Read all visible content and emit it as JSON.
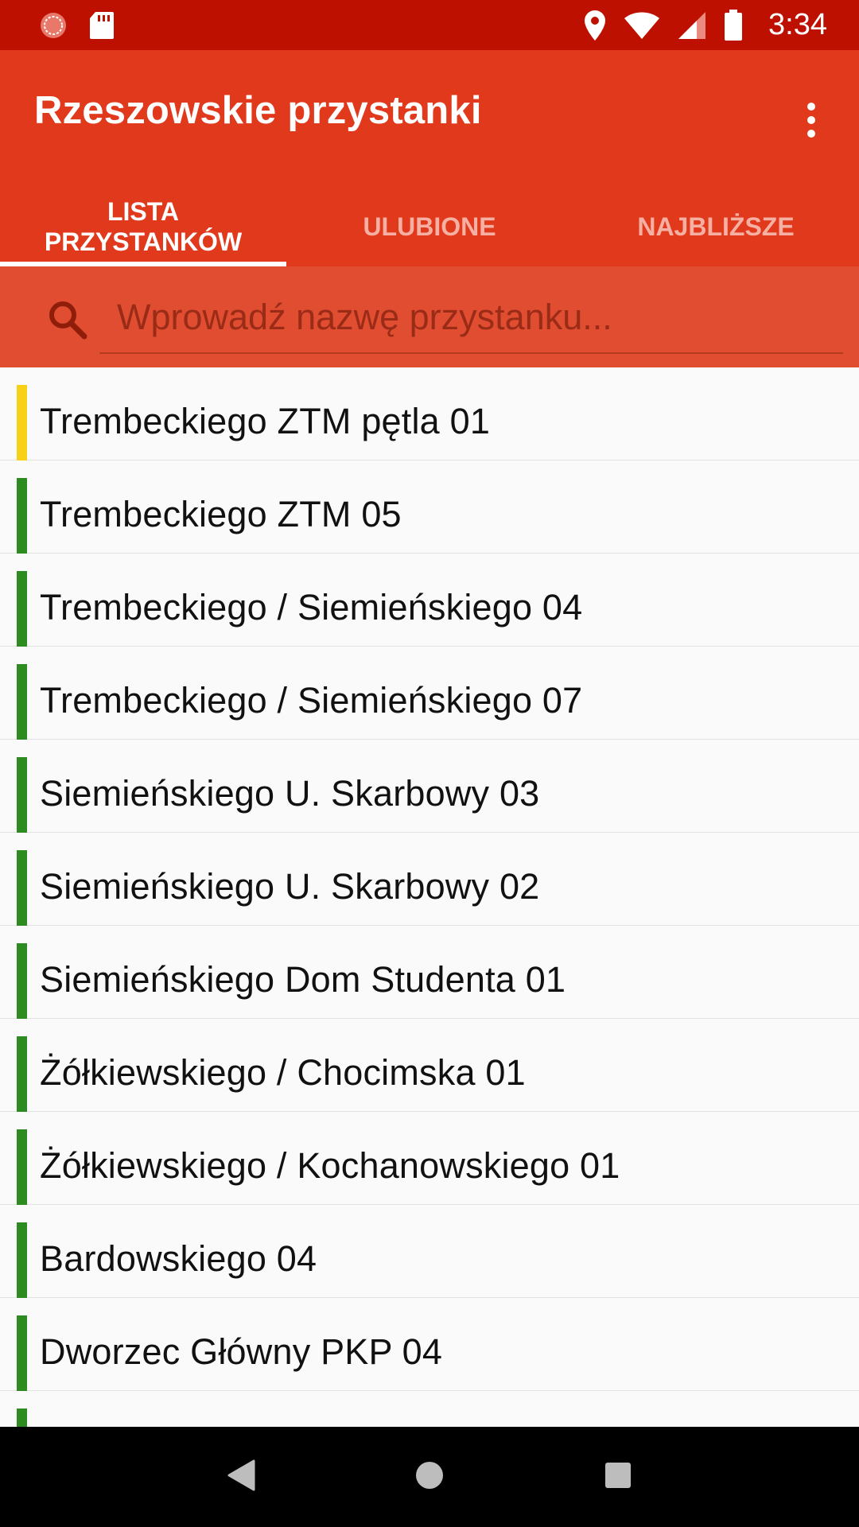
{
  "status_bar": {
    "time": "3:34",
    "icons": [
      "notification-circle-icon",
      "sd-card-icon",
      "location-pin-icon",
      "wifi-icon",
      "cell-signal-icon",
      "battery-icon"
    ]
  },
  "app_bar": {
    "title": "Rzeszowskie przystanki",
    "overflow_icon": "more-vert-icon",
    "tabs": [
      {
        "label": "LISTA\nPRZYSTANKÓW",
        "label_line1": "LISTA",
        "label_line2": "PRZYSTANKÓW",
        "active": true
      },
      {
        "label": "ULUBIONE",
        "active": false
      },
      {
        "label": "NAJBLIŻSZE",
        "active": false
      }
    ]
  },
  "search": {
    "placeholder": "Wprowadź nazwę przystanku...",
    "value": "",
    "icon": "search-icon"
  },
  "stops": [
    {
      "name": "Trembeckiego ZTM pętla 01",
      "color": "#f7d117"
    },
    {
      "name": "Trembeckiego ZTM 05",
      "color": "#2e8b22"
    },
    {
      "name": "Trembeckiego / Siemieńskiego 04",
      "color": "#2e8b22"
    },
    {
      "name": "Trembeckiego / Siemieńskiego 07",
      "color": "#2e8b22"
    },
    {
      "name": "Siemieńskiego U. Skarbowy 03",
      "color": "#2e8b22"
    },
    {
      "name": "Siemieńskiego U. Skarbowy 02",
      "color": "#2e8b22"
    },
    {
      "name": "Siemieńskiego Dom Studenta 01",
      "color": "#2e8b22"
    },
    {
      "name": "Żółkiewskiego / Chocimska 01",
      "color": "#2e8b22"
    },
    {
      "name": "Żółkiewskiego / Kochanowskiego 01",
      "color": "#2e8b22"
    },
    {
      "name": "Bardowskiego 04",
      "color": "#2e8b22"
    },
    {
      "name": "Dworzec Główny PKP 04",
      "color": "#2e8b22"
    },
    {
      "name": "",
      "color": "#2e8b22"
    }
  ],
  "nav_bar": {
    "buttons": [
      "back-icon",
      "home-icon",
      "recents-icon"
    ]
  },
  "colors": {
    "status_bar": "#bd1000",
    "app_bar": "#e0391c",
    "search_bar": "#e14d30"
  }
}
